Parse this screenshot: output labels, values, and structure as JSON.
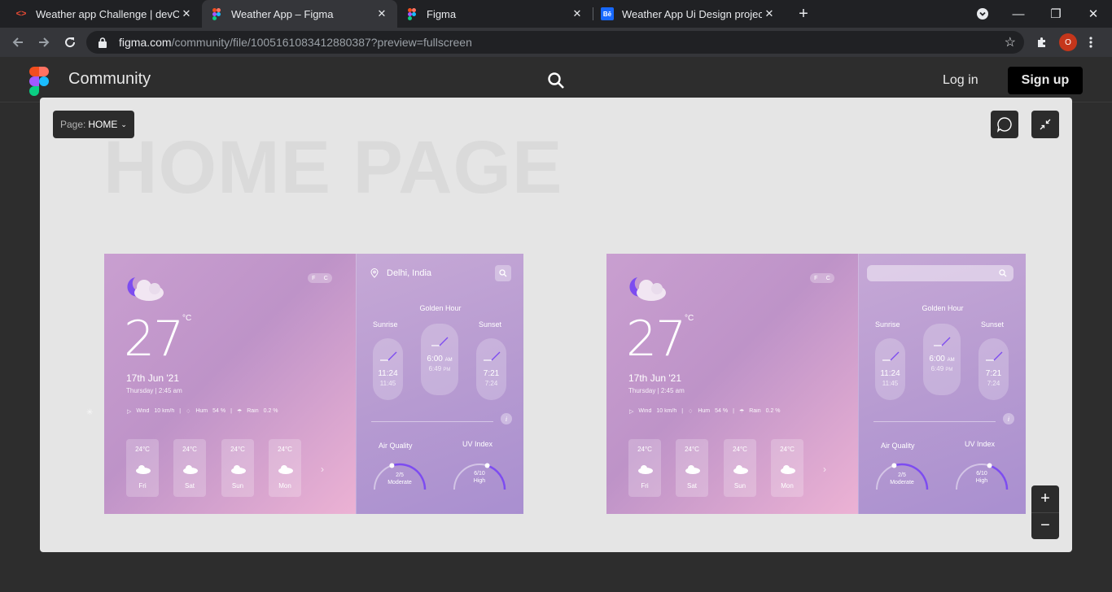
{
  "browser": {
    "tabs": [
      {
        "title": "Weather app Challenge | devChal",
        "icon": "devchallenges-icon",
        "active": false
      },
      {
        "title": "Weather App – Figma",
        "icon": "figma-icon",
        "active": true
      },
      {
        "title": "Figma",
        "icon": "figma-icon",
        "active": false
      },
      {
        "title": "Weather App Ui Design projects",
        "icon": "behance-icon",
        "active": false
      }
    ],
    "url_host": "figma.com",
    "url_path": "/community/file/1005161083412880387?preview=fullscreen",
    "profile_initial": "O"
  },
  "header": {
    "title": "Community",
    "login": "Log in",
    "signup": "Sign up"
  },
  "canvas": {
    "page_label": "Page:",
    "page_name": "HOME",
    "frame_title": "HOME PAGE"
  },
  "weather": {
    "fc": [
      "F",
      "C"
    ],
    "temp": "27",
    "deg": "°C",
    "date": "17th Jun '21",
    "day": "Thursday  |  2:45 am",
    "wind_label": "Wind",
    "wind_value": "10 km/h",
    "hum_label": "Hum",
    "hum_value": "54 %",
    "rain_label": "Rain",
    "rain_value": "0.2 %",
    "forecast": [
      {
        "temp": "24°C",
        "day": "Fri"
      },
      {
        "temp": "24°C",
        "day": "Sat"
      },
      {
        "temp": "24°C",
        "day": "Sun"
      },
      {
        "temp": "24°C",
        "day": "Mon"
      }
    ],
    "location": "Delhi, India",
    "golden_hour": "Golden Hour",
    "sunrise_label": "Sunrise",
    "sunset_label": "Sunset",
    "sunrise": {
      "time": "11:24",
      "sub": "11:45"
    },
    "golden": {
      "time": "6:00",
      "time_suffix": "AM",
      "sub": "6:49",
      "sub_suffix": "PM"
    },
    "sunset": {
      "time": "7:21",
      "sub": "7:24"
    },
    "info": "i",
    "air_quality_label": "Air Quality",
    "air_quality_value": "2/5",
    "air_quality_level": 0.4,
    "air_quality_text": "Moderate",
    "uv_label": "UV Index",
    "uv_value": "6/10",
    "uv_level": 0.6,
    "uv_text": "High"
  },
  "colors": {
    "accent_purple": "#7d4cf0",
    "figma_red": "#f24e1e",
    "figma_orange": "#ff7262",
    "figma_purple": "#a259ff",
    "figma_blue": "#1abcfe",
    "figma_green": "#0acf83"
  }
}
